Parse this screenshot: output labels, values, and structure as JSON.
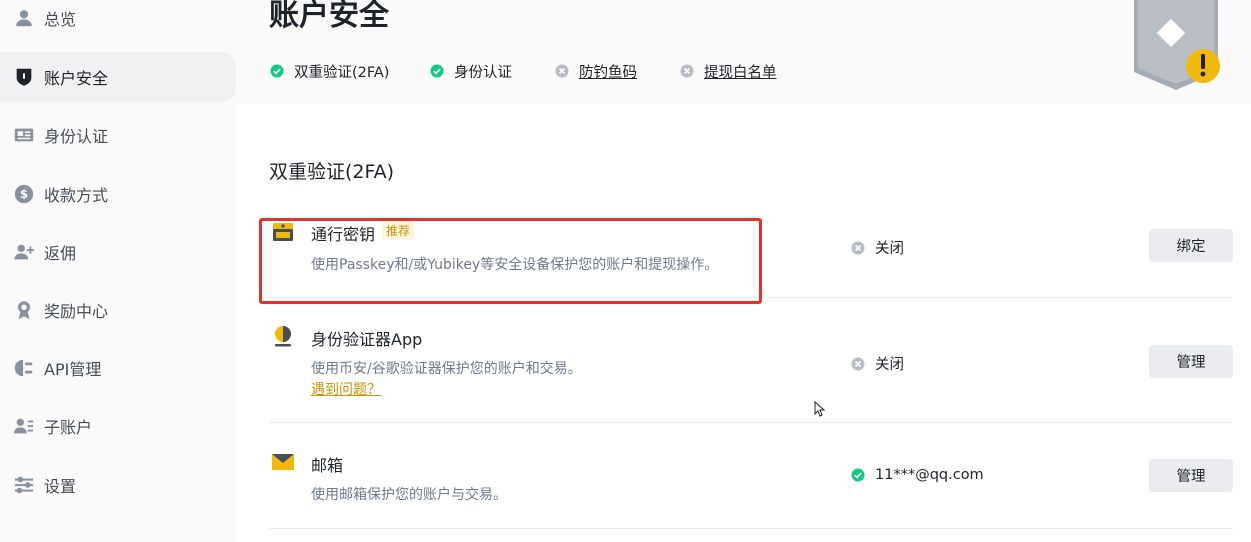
{
  "sidebar": {
    "items": [
      {
        "label": "总览",
        "icon": "user-icon"
      },
      {
        "label": "账户安全",
        "icon": "shield-icon",
        "active": true
      },
      {
        "label": "身份认证",
        "icon": "id-card-icon"
      },
      {
        "label": "收款方式",
        "icon": "dollar-icon"
      },
      {
        "label": "返佣",
        "icon": "add-user-icon"
      },
      {
        "label": "奖励中心",
        "icon": "medal-icon"
      },
      {
        "label": "API管理",
        "icon": "api-icon"
      },
      {
        "label": "子账户",
        "icon": "sub-account-icon"
      },
      {
        "label": "设置",
        "icon": "sliders-icon"
      }
    ]
  },
  "header": {
    "title": "账户安全",
    "summary": [
      {
        "label": "双重验证(2FA)",
        "status": "enabled"
      },
      {
        "label": "身份认证",
        "status": "enabled"
      },
      {
        "label": "防钓鱼码",
        "status": "disabled"
      },
      {
        "label": "提现白名单",
        "status": "disabled"
      }
    ]
  },
  "section": {
    "title": "双重验证(2FA)",
    "rows": [
      {
        "title": "通行密钥",
        "tag": "推荐",
        "desc": "使用Passkey和/或Yubikey等安全设备保护您的账户和提现操作。",
        "status": "关闭",
        "status_type": "off",
        "button": "绑定",
        "icon": "passkey-icon"
      },
      {
        "title": "身份验证器App",
        "desc": "使用币安/谷歌验证器保护您的账户和交易。",
        "link": "遇到问题？",
        "status": "关闭",
        "status_type": "off",
        "button": "管理",
        "icon": "authenticator-icon"
      },
      {
        "title": "邮箱",
        "desc": "使用邮箱保护您的账户与交易。",
        "status": "11***@qq.com",
        "status_type": "on",
        "button": "管理",
        "icon": "email-icon"
      }
    ]
  },
  "colors": {
    "accent": "#f0b90b",
    "success": "#0ecb81",
    "inactive": "#b7bdc6",
    "highlight": "#e5312c"
  }
}
